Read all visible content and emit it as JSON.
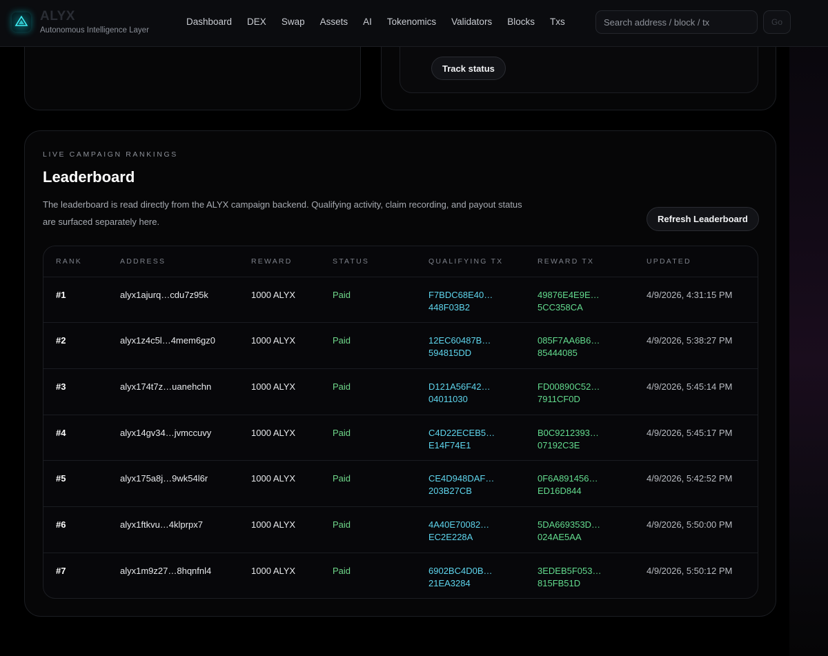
{
  "brand": {
    "title": "ALYX",
    "subtitle": "Autonomous Intelligence Layer",
    "logo_text": "ALYX"
  },
  "nav": {
    "items": [
      "Dashboard",
      "DEX",
      "Swap",
      "Assets",
      "AI",
      "Tokenomics",
      "Validators",
      "Blocks",
      "Txs"
    ]
  },
  "search": {
    "placeholder": "Search address / block / tx",
    "go_label": "Go"
  },
  "status_card": {
    "track_label": "Track status"
  },
  "leaderboard": {
    "eyebrow": "LIVE CAMPAIGN RANKINGS",
    "title": "Leaderboard",
    "description": "The leaderboard is read directly from the ALYX campaign backend. Qualifying activity, claim recording, and payout status are surfaced separately here.",
    "refresh_label": "Refresh Leaderboard",
    "columns": [
      "RANK",
      "ADDRESS",
      "REWARD",
      "STATUS",
      "QUALIFYING TX",
      "REWARD TX",
      "UPDATED"
    ],
    "rows": [
      {
        "rank": "#1",
        "address": "alyx1ajurq…cdu7z95k",
        "reward": "1000 ALYX",
        "status": "Paid",
        "qtx1": "F7BDC68E40…",
        "qtx2": "448F03B2",
        "rtx1": "49876E4E9E…",
        "rtx2": "5CC358CA",
        "updated": "4/9/2026, 4:31:15 PM"
      },
      {
        "rank": "#2",
        "address": "alyx1z4c5l…4mem6gz0",
        "reward": "1000 ALYX",
        "status": "Paid",
        "qtx1": "12EC60487B…",
        "qtx2": "594815DD",
        "rtx1": "085F7AA6B6…",
        "rtx2": "85444085",
        "updated": "4/9/2026, 5:38:27 PM"
      },
      {
        "rank": "#3",
        "address": "alyx174t7z…uanehchn",
        "reward": "1000 ALYX",
        "status": "Paid",
        "qtx1": "D121A56F42…",
        "qtx2": "04011030",
        "rtx1": "FD00890C52…",
        "rtx2": "7911CF0D",
        "updated": "4/9/2026, 5:45:14 PM"
      },
      {
        "rank": "#4",
        "address": "alyx14gv34…jvmccuvy",
        "reward": "1000 ALYX",
        "status": "Paid",
        "qtx1": "C4D22ECEB5…",
        "qtx2": "E14F74E1",
        "rtx1": "B0C9212393…",
        "rtx2": "07192C3E",
        "updated": "4/9/2026, 5:45:17 PM"
      },
      {
        "rank": "#5",
        "address": "alyx175a8j…9wk54l6r",
        "reward": "1000 ALYX",
        "status": "Paid",
        "qtx1": "CE4D948DAF…",
        "qtx2": "203B27CB",
        "rtx1": "0F6A891456…",
        "rtx2": "ED16D844",
        "updated": "4/9/2026, 5:42:52 PM"
      },
      {
        "rank": "#6",
        "address": "alyx1ftkvu…4klprpx7",
        "reward": "1000 ALYX",
        "status": "Paid",
        "qtx1": "4A40E70082…",
        "qtx2": "EC2E228A",
        "rtx1": "5DA669353D…",
        "rtx2": "024AE5AA",
        "updated": "4/9/2026, 5:50:00 PM"
      },
      {
        "rank": "#7",
        "address": "alyx1m9z27…8hqnfnl4",
        "reward": "1000 ALYX",
        "status": "Paid",
        "qtx1": "6902BC4D0B…",
        "qtx2": "21EA3284",
        "rtx1": "3EDEB5F053…",
        "rtx2": "815FB51D",
        "updated": "4/9/2026, 5:50:12 PM"
      }
    ]
  },
  "colors": {
    "accent_cyan": "#5fd6ee",
    "accent_green": "#63dc8e",
    "status_paid": "#6fd88a",
    "background": "#000000"
  },
  "icons": {
    "logo": "triangle-logo-icon"
  }
}
